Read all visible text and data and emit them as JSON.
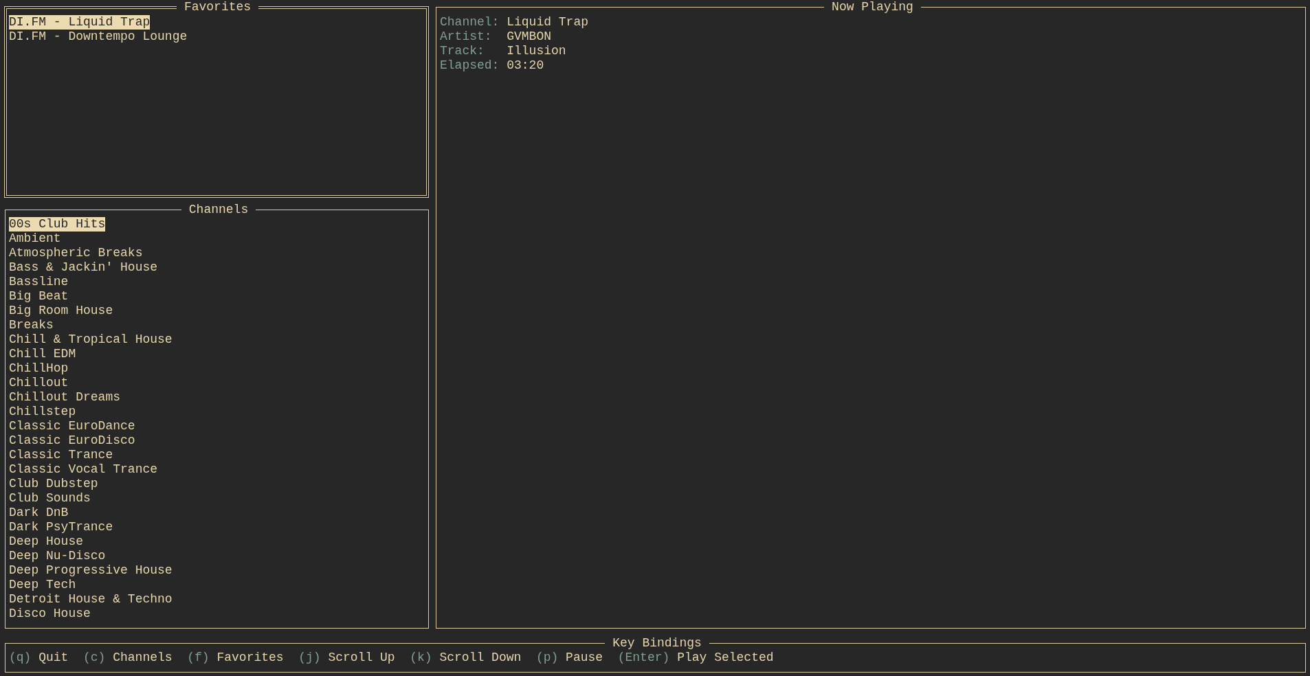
{
  "favorites": {
    "title": "Favorites",
    "focused": true,
    "items": [
      {
        "label": "DI.FM - Liquid Trap",
        "selected": true
      },
      {
        "label": "DI.FM - Downtempo Lounge",
        "selected": false
      }
    ]
  },
  "channels": {
    "title": "Channels",
    "focused": false,
    "items": [
      {
        "label": "00s Club Hits",
        "selected": true
      },
      {
        "label": "Ambient",
        "selected": false
      },
      {
        "label": "Atmospheric Breaks",
        "selected": false
      },
      {
        "label": "Bass & Jackin' House",
        "selected": false
      },
      {
        "label": "Bassline",
        "selected": false
      },
      {
        "label": "Big Beat",
        "selected": false
      },
      {
        "label": "Big Room House",
        "selected": false
      },
      {
        "label": "Breaks",
        "selected": false
      },
      {
        "label": "Chill & Tropical House",
        "selected": false
      },
      {
        "label": "Chill EDM",
        "selected": false
      },
      {
        "label": "ChillHop",
        "selected": false
      },
      {
        "label": "Chillout",
        "selected": false
      },
      {
        "label": "Chillout Dreams",
        "selected": false
      },
      {
        "label": "Chillstep",
        "selected": false
      },
      {
        "label": "Classic EuroDance",
        "selected": false
      },
      {
        "label": "Classic EuroDisco",
        "selected": false
      },
      {
        "label": "Classic Trance",
        "selected": false
      },
      {
        "label": "Classic Vocal Trance",
        "selected": false
      },
      {
        "label": "Club Dubstep",
        "selected": false
      },
      {
        "label": "Club Sounds",
        "selected": false
      },
      {
        "label": "Dark DnB",
        "selected": false
      },
      {
        "label": "Dark PsyTrance",
        "selected": false
      },
      {
        "label": "Deep House",
        "selected": false
      },
      {
        "label": "Deep Nu-Disco",
        "selected": false
      },
      {
        "label": "Deep Progressive House",
        "selected": false
      },
      {
        "label": "Deep Tech",
        "selected": false
      },
      {
        "label": "Detroit House & Techno",
        "selected": false
      },
      {
        "label": "Disco House",
        "selected": false
      }
    ]
  },
  "now_playing": {
    "title": "Now Playing",
    "fields": [
      {
        "label": "Channel:",
        "value": "Liquid Trap"
      },
      {
        "label": "Artist:",
        "value": "GVMBON"
      },
      {
        "label": "Track:",
        "value": "Illusion"
      },
      {
        "label": "Elapsed:",
        "value": "03:20"
      }
    ]
  },
  "key_bindings": {
    "title": "Key Bindings",
    "items": [
      {
        "key": "(q)",
        "action": "Quit"
      },
      {
        "key": "(c)",
        "action": "Channels"
      },
      {
        "key": "(f)",
        "action": "Favorites"
      },
      {
        "key": "(j)",
        "action": "Scroll Up"
      },
      {
        "key": "(k)",
        "action": "Scroll Down"
      },
      {
        "key": "(p)",
        "action": "Pause"
      },
      {
        "key": "(Enter)",
        "action": "Play Selected"
      }
    ]
  }
}
